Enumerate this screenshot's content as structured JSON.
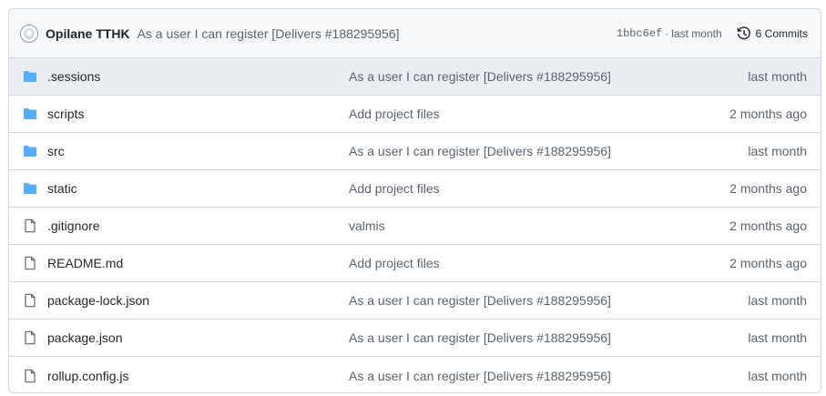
{
  "latest_commit": {
    "author": "Opilane TTHK",
    "message": "As a user I can register [Delivers #188295956]",
    "sha": "1bbc6ef",
    "separator": "·",
    "time": "last month",
    "commits_label": "6 Commits"
  },
  "files": [
    {
      "name": ".sessions",
      "type": "folder",
      "message": "As a user I can register [Delivers #188295956]",
      "age": "last month"
    },
    {
      "name": "scripts",
      "type": "folder",
      "message": "Add project files",
      "age": "2 months ago"
    },
    {
      "name": "src",
      "type": "folder",
      "message": "As a user I can register [Delivers #188295956]",
      "age": "last month"
    },
    {
      "name": "static",
      "type": "folder",
      "message": "Add project files",
      "age": "2 months ago"
    },
    {
      "name": ".gitignore",
      "type": "file",
      "message": "valmis",
      "age": "2 months ago"
    },
    {
      "name": "README.md",
      "type": "file",
      "message": "Add project files",
      "age": "2 months ago"
    },
    {
      "name": "package-lock.json",
      "type": "file",
      "message": "As a user I can register [Delivers #188295956]",
      "age": "last month"
    },
    {
      "name": "package.json",
      "type": "file",
      "message": "As a user I can register [Delivers #188295956]",
      "age": "last month"
    },
    {
      "name": "rollup.config.js",
      "type": "file",
      "message": "As a user I can register [Delivers #188295956]",
      "age": "last month"
    }
  ],
  "colors": {
    "folder_icon": "#54aeff",
    "file_icon": "#59636e",
    "header_bg": "#f6f8fa",
    "highlight_row_bg": "#eaeef2",
    "border": "#d0d7de"
  }
}
